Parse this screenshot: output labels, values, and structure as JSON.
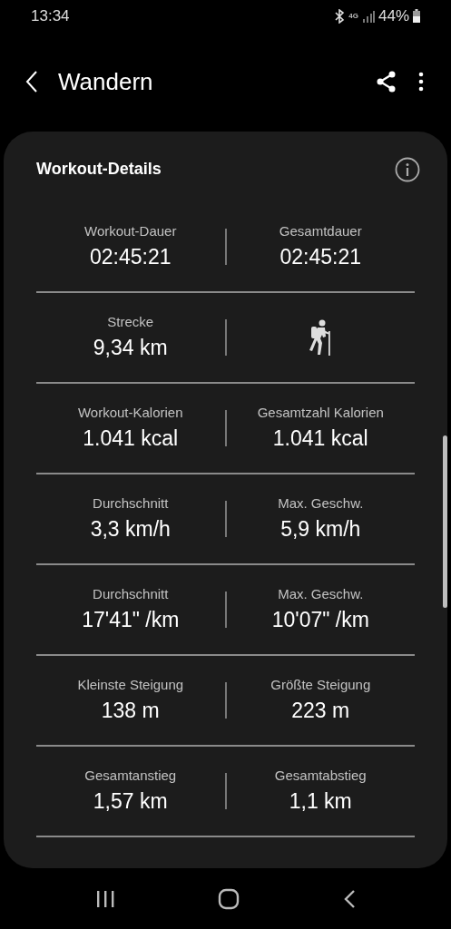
{
  "status_bar": {
    "time": "13:34",
    "network": "4G",
    "battery": "44%"
  },
  "header": {
    "title": "Wandern"
  },
  "card": {
    "title": "Workout-Details",
    "rows": [
      {
        "left": {
          "kind": "stat",
          "label": "Workout-Dauer",
          "value": "02:45:21"
        },
        "right": {
          "kind": "stat",
          "label": "Gesamtdauer",
          "value": "02:45:21"
        }
      },
      {
        "left": {
          "kind": "stat",
          "label": "Strecke",
          "value": "9,34 km"
        },
        "right": {
          "kind": "hiker"
        }
      },
      {
        "left": {
          "kind": "stat",
          "label": "Workout-Kalorien",
          "value": "1.041 kcal"
        },
        "right": {
          "kind": "stat",
          "label": "Gesamtzahl Kalorien",
          "value": "1.041 kcal"
        }
      },
      {
        "left": {
          "kind": "stat",
          "label": "Durchschnitt",
          "value": "3,3 km/h"
        },
        "right": {
          "kind": "stat",
          "label": "Max. Geschw.",
          "value": "5,9 km/h"
        }
      },
      {
        "left": {
          "kind": "stat",
          "label": "Durchschnitt",
          "value": "17'41\" /km"
        },
        "right": {
          "kind": "stat",
          "label": "Max. Geschw.",
          "value": "10'07\" /km"
        }
      },
      {
        "left": {
          "kind": "stat",
          "label": "Kleinste Steigung",
          "value": "138 m"
        },
        "right": {
          "kind": "stat",
          "label": "Größte Steigung",
          "value": "223 m"
        }
      },
      {
        "left": {
          "kind": "stat",
          "label": "Gesamtanstieg",
          "value": "1,57 km"
        },
        "right": {
          "kind": "stat",
          "label": "Gesamtabstieg",
          "value": "1,1 km"
        }
      }
    ]
  }
}
